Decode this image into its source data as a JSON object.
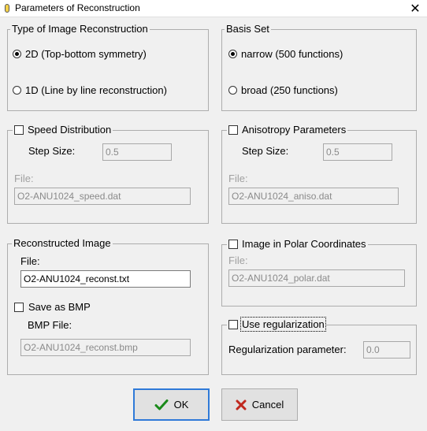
{
  "window": {
    "title": "Parameters of Reconstruction",
    "close_glyph": "✕"
  },
  "type_group": {
    "title": "Type of Image Reconstruction",
    "options": [
      "2D (Top-bottom symmetry)",
      "1D (Line by line reconstruction)"
    ],
    "selected": 0
  },
  "basis_group": {
    "title": "Basis Set",
    "options": [
      "narrow (500 functions)",
      "broad (250 functions)"
    ],
    "selected": 0
  },
  "speed_group": {
    "title": "Speed Distribution",
    "checked": false,
    "step_label": "Step Size:",
    "step_value": "0.5",
    "file_label": "File:",
    "file_value": "O2-ANU1024_speed.dat"
  },
  "aniso_group": {
    "title": "Anisotropy Parameters",
    "checked": false,
    "step_label": "Step Size:",
    "step_value": "0.5",
    "file_label": "File:",
    "file_value": "O2-ANU1024_aniso.dat"
  },
  "recon_group": {
    "title": "Reconstructed Image",
    "file_label": "File:",
    "file_value": "O2-ANU1024_reconst.txt",
    "bmp_label": "Save as BMP",
    "bmp_checked": false,
    "bmp_file_label": "BMP File:",
    "bmp_file_value": "O2-ANU1024_reconst.bmp"
  },
  "polar_group": {
    "title": "Image in Polar Coordinates",
    "checked": false,
    "file_label": "File:",
    "file_value": "O2-ANU1024_polar.dat"
  },
  "reg_group": {
    "title": "Use regularization",
    "checked": false,
    "param_label": "Regularization parameter:",
    "param_value": "0.0"
  },
  "buttons": {
    "ok": "OK",
    "cancel": "Cancel"
  },
  "colors": {
    "ok_check": "#1a8a1a",
    "cancel_x": "#c0281e",
    "default_border": "#2f7ad8"
  }
}
